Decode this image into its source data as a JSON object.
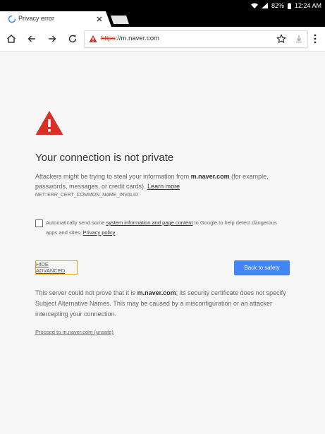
{
  "status_bar": {
    "battery": "82%",
    "time": "12:24 AM"
  },
  "tabs": [
    {
      "title": "Privacy error",
      "active": true
    }
  ],
  "omnibox": {
    "url_scheme": "https",
    "url_rest": "://m.naver.com"
  },
  "interstitial": {
    "heading": "Your connection is not private",
    "explanation_prefix": "Attackers might be trying to steal your information from ",
    "explanation_domain": "m.naver.com",
    "explanation_suffix": " (for example, passwords, messages, or credit cards). ",
    "learn_more": "Learn more",
    "error_code": "NET::ERR_CERT_COMMON_NAME_INVALID",
    "checkbox_prefix": "Automatically send some ",
    "checkbox_link": "system information and page content",
    "checkbox_mid": " to Google to help detect dangerous apps and sites. ",
    "privacy_policy": "Privacy policy",
    "hide_advanced": "HIDE ADVANCED",
    "back_to_safety": "Back to safety",
    "details_prefix": "This server could not prove that it is ",
    "details_domain": "m.naver.com",
    "details_suffix": "; its security certificate does not specify Subject Alternative Names. This may be caused by a misconfiguration or an attacker intercepting your connection.",
    "proceed_link": "Proceed to m.naver.com (unsafe)"
  },
  "colors": {
    "danger": "#d93025",
    "primary_button": "#4285f4",
    "focus_outline": "#f0a30a"
  }
}
